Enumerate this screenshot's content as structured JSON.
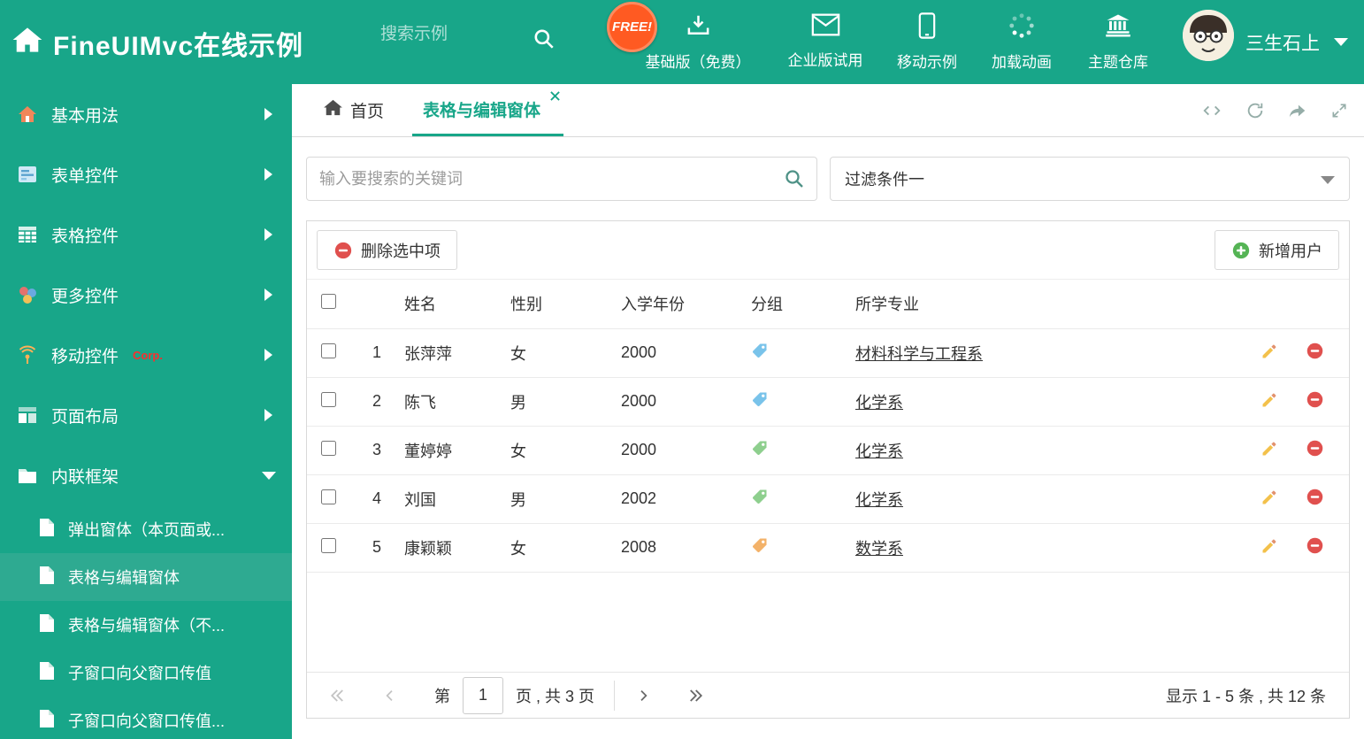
{
  "colors": {
    "accent": "#18a689"
  },
  "header": {
    "title": "FineUIMvc在线示例",
    "search_placeholder": "搜索示例",
    "free_badge": "FREE!",
    "nav": [
      {
        "label": "基础版（免费）"
      },
      {
        "label": "企业版试用"
      },
      {
        "label": "移动示例"
      },
      {
        "label": "加载动画"
      },
      {
        "label": "主题仓库"
      }
    ],
    "user_name": "三生石上"
  },
  "sidebar": {
    "items": [
      {
        "label": "基本用法"
      },
      {
        "label": "表单控件"
      },
      {
        "label": "表格控件"
      },
      {
        "label": "更多控件"
      },
      {
        "label": "移动控件",
        "badge": "Corp."
      },
      {
        "label": "页面布局"
      },
      {
        "label": "内联框架"
      }
    ],
    "subitems": [
      {
        "label": "弹出窗体（本页面或..."
      },
      {
        "label": "表格与编辑窗体"
      },
      {
        "label": "表格与编辑窗体（不..."
      },
      {
        "label": "子窗口向父窗口传值"
      },
      {
        "label": "子窗口向父窗口传值..."
      }
    ]
  },
  "tabs": {
    "home": "首页",
    "active": "表格与编辑窗体"
  },
  "filter": {
    "search_placeholder": "输入要搜索的关键词",
    "dropdown_value": "过滤条件一"
  },
  "toolbar": {
    "delete": "删除选中项",
    "add": "新增用户"
  },
  "table": {
    "columns": [
      "姓名",
      "性别",
      "入学年份",
      "分组",
      "所学专业"
    ],
    "rows": [
      {
        "num": "1",
        "name": "张萍萍",
        "gender": "女",
        "year": "2000",
        "tag": "#79c3ea",
        "major": "材料科学与工程系"
      },
      {
        "num": "2",
        "name": "陈飞",
        "gender": "男",
        "year": "2000",
        "tag": "#79c3ea",
        "major": "化学系"
      },
      {
        "num": "3",
        "name": "董婷婷",
        "gender": "女",
        "year": "2000",
        "tag": "#8ecf8e",
        "major": "化学系"
      },
      {
        "num": "4",
        "name": "刘国",
        "gender": "男",
        "year": "2002",
        "tag": "#8ecf8e",
        "major": "化学系"
      },
      {
        "num": "5",
        "name": "康颖颖",
        "gender": "女",
        "year": "2008",
        "tag": "#f3b269",
        "major": "数学系"
      }
    ]
  },
  "pagination": {
    "prefix": "第",
    "page": "1",
    "suffix": "页 , 共 3 页",
    "summary": "显示 1 - 5 条 , 共 12 条"
  }
}
